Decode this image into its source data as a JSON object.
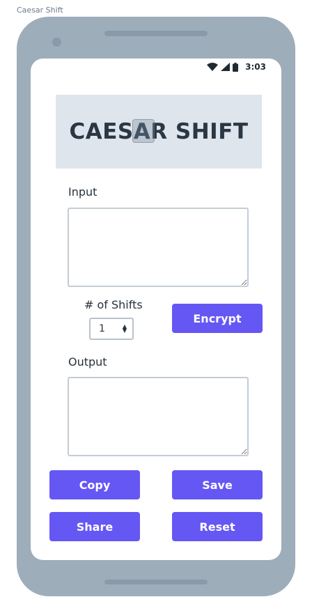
{
  "frame": {
    "label": "Caesar Shift"
  },
  "status_bar": {
    "time": "3:03",
    "icons": [
      "wifi-icon",
      "signal-icon",
      "battery-icon"
    ]
  },
  "banner": {
    "title": "CAESAR SHIFT"
  },
  "input": {
    "label": "Input",
    "value": ""
  },
  "shifts": {
    "label": "# of Shifts",
    "selected": "1"
  },
  "output": {
    "label": "Output",
    "value": ""
  },
  "buttons": {
    "encrypt": "Encrypt",
    "copy": "Copy",
    "save": "Save",
    "share": "Share",
    "reset": "Reset"
  },
  "colors": {
    "accent": "#6557f3",
    "phone_body": "#9eadba",
    "banner_bg": "#dfe5ec",
    "banner_text": "#2a3744"
  }
}
